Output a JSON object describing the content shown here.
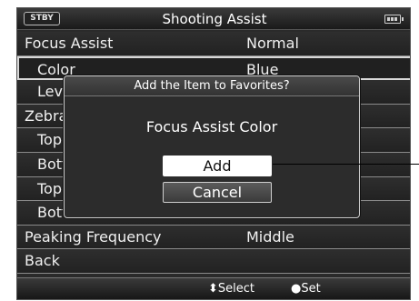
{
  "status": {
    "stby": "STBY"
  },
  "screen": {
    "title": "Shooting Assist",
    "battery_icon": "battery-icon"
  },
  "menu": {
    "rows": [
      {
        "label": "Focus Assist",
        "value": "Normal"
      },
      {
        "label": "Color",
        "value": "Blue",
        "selected": true
      },
      {
        "label": "Leve",
        "value": ""
      },
      {
        "label": "Zebra",
        "value": ""
      },
      {
        "label": "Top",
        "value": ""
      },
      {
        "label": "Bott",
        "value": ""
      },
      {
        "label": "Top",
        "value": ""
      },
      {
        "label": "Bott",
        "value": ""
      },
      {
        "label": "Peaking Frequency",
        "value": "Middle"
      },
      {
        "label": "Back",
        "value": ""
      }
    ]
  },
  "dialog": {
    "title": "Add the Item to Favorites?",
    "message": "Focus Assist Color",
    "buttons": {
      "add": "Add",
      "cancel": "Cancel"
    }
  },
  "footer": {
    "select": "⬍Select",
    "set": "●Set"
  }
}
